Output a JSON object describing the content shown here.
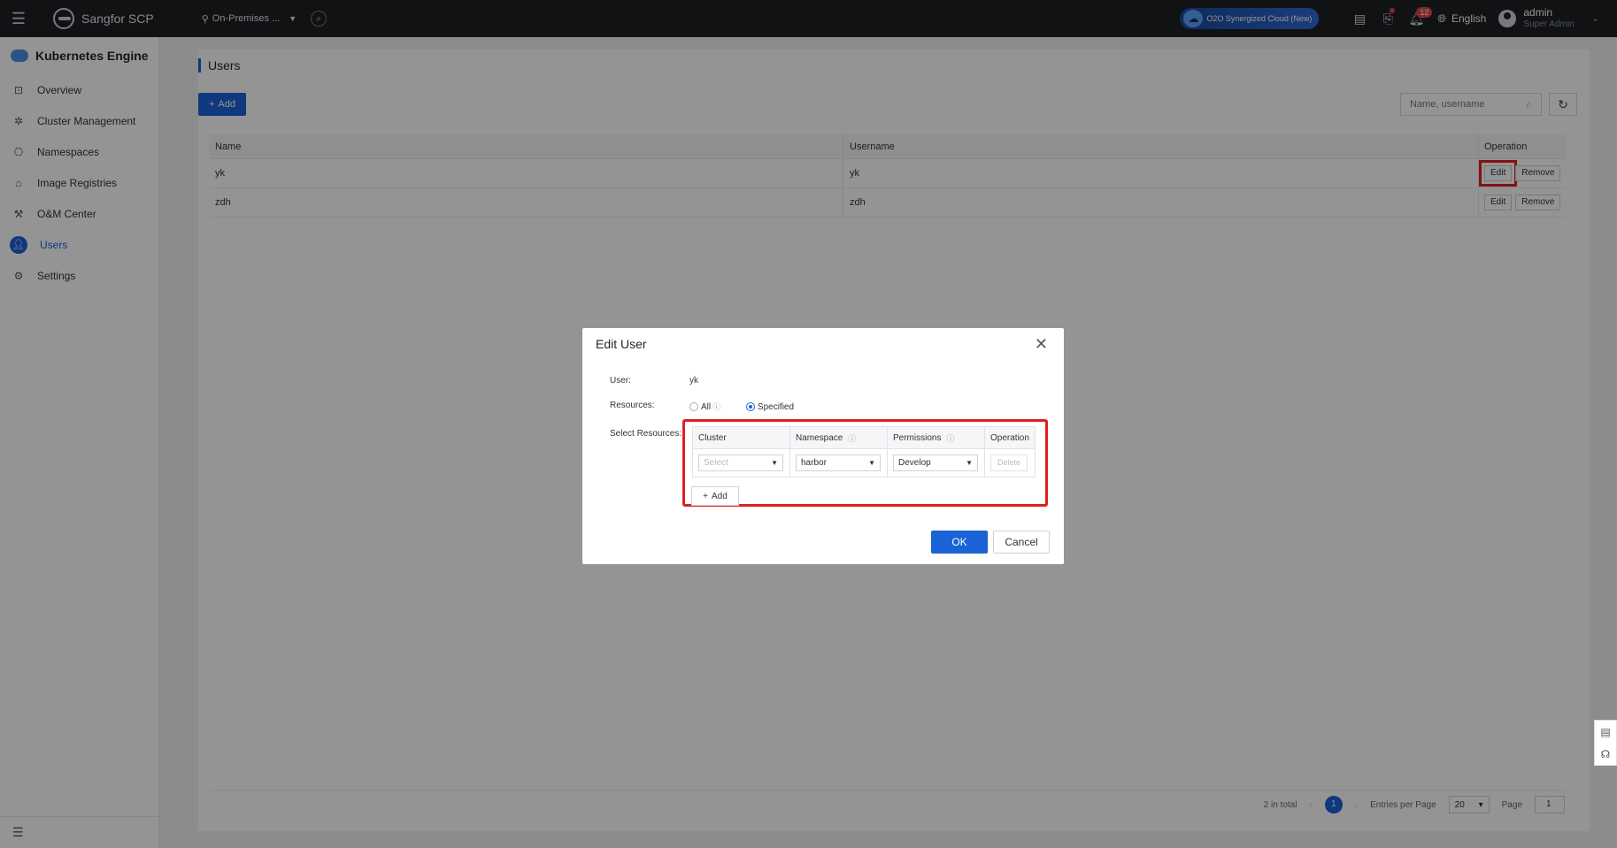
{
  "topbar": {
    "brand": "Sangfor SCP",
    "region": "On-Premises ...",
    "cloud_button": "O2O Synergized Cloud (New)",
    "notification_count": "12",
    "language": "English",
    "user_name": "admin",
    "user_role": "Super Admin"
  },
  "sidebar": {
    "title": "Kubernetes Engine",
    "items": [
      {
        "label": "Overview",
        "icon": "monitor-icon"
      },
      {
        "label": "Cluster Management",
        "icon": "cluster-icon"
      },
      {
        "label": "Namespaces",
        "icon": "namespace-icon"
      },
      {
        "label": "Image Registries",
        "icon": "registry-icon"
      },
      {
        "label": "O&M Center",
        "icon": "wrench-icon"
      },
      {
        "label": "Users",
        "icon": "user-icon",
        "active": true
      },
      {
        "label": "Settings",
        "icon": "gear-icon"
      }
    ]
  },
  "main": {
    "title": "Users",
    "add_label": "Add",
    "search_placeholder": "Name, username",
    "columns": [
      "Name",
      "Username",
      "Operation"
    ],
    "rows": [
      {
        "name": "yk",
        "username": "yk",
        "edit": "Edit",
        "remove": "Remove"
      },
      {
        "name": "zdh",
        "username": "zdh",
        "edit": "Edit",
        "remove": "Remove"
      }
    ],
    "pager": {
      "total": "2 in total",
      "current_page": "1",
      "entries_label": "Entries per Page",
      "entries_value": "20",
      "page_label": "Page",
      "page_value": "1"
    }
  },
  "modal": {
    "title": "Edit User",
    "user_label": "User:",
    "user_value": "yk",
    "resources_label": "Resources:",
    "option_all": "All",
    "option_specified": "Specified",
    "selected_option": "Specified",
    "select_resources_label": "Select Resources:",
    "columns": [
      "Cluster",
      "Namespace",
      "Permissions",
      "Operation"
    ],
    "row": {
      "cluster_placeholder": "Select",
      "namespace": "harbor",
      "permissions": "Develop",
      "delete": "Delete"
    },
    "add_label": "Add",
    "ok_label": "OK",
    "cancel_label": "Cancel"
  },
  "colors": {
    "accent": "#1a63d6",
    "highlight": "#e02020",
    "topbar": "#1d1f24"
  }
}
